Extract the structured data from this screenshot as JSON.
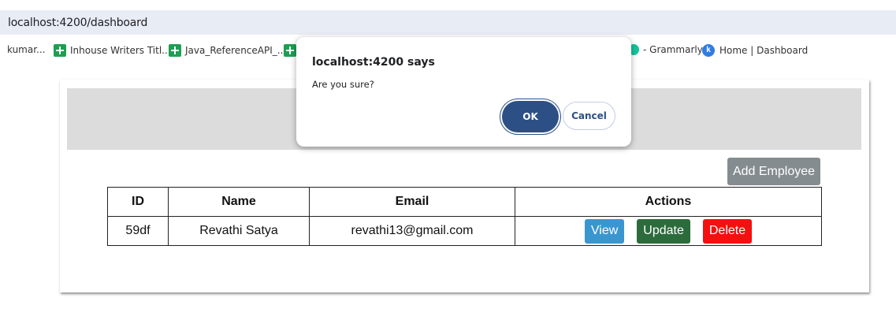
{
  "browser": {
    "url": "localhost:4200/dashboard",
    "bookmarks": [
      {
        "label": "kumar...",
        "icon": "none"
      },
      {
        "label": "Inhouse Writers Titl...",
        "icon": "sheets-icon"
      },
      {
        "label": "Java_ReferenceAPI_...",
        "icon": "sheets-icon"
      },
      {
        "label": "",
        "icon": "sheets-icon"
      },
      {
        "label": "- Grammarly",
        "icon": "grammarly-icon"
      },
      {
        "label": "Home | Dashboard",
        "icon": "k-icon"
      }
    ],
    "k_icon_letter": "k"
  },
  "app": {
    "add_button_label": "Add Employee",
    "table": {
      "headers": [
        "ID",
        "Name",
        "Email",
        "Actions"
      ],
      "rows": [
        {
          "id": "59df",
          "name": "Revathi Satya",
          "email": "revathi13@gmail.com"
        }
      ]
    },
    "actions": {
      "view": "View",
      "update": "Update",
      "delete": "Delete"
    }
  },
  "dialog": {
    "title": "localhost:4200 says",
    "message": "Are you sure?",
    "ok_label": "OK",
    "cancel_label": "Cancel"
  },
  "colors": {
    "view": "#3a96cf",
    "update": "#2c6b3c",
    "delete": "#f50f0f",
    "add": "#858c8f",
    "ok": "#2c4f86"
  }
}
